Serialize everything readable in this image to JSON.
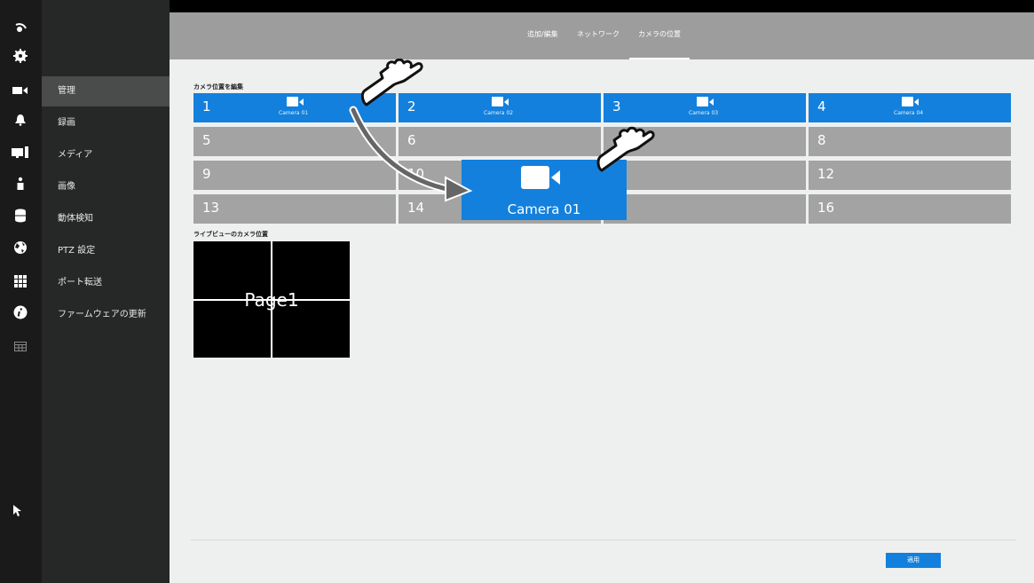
{
  "tabs": [
    {
      "label": "追加/編集"
    },
    {
      "label": "ネットワーク"
    },
    {
      "label": "カメラの位置"
    }
  ],
  "sidebar": {
    "items": [
      {
        "label": "管理",
        "icon": "camera-icon"
      },
      {
        "label": "録画",
        "icon": "bell-icon"
      },
      {
        "label": "メディア",
        "icon": "monitor-icon"
      },
      {
        "label": "画像",
        "icon": "person-icon"
      },
      {
        "label": "動体検知",
        "icon": "database-icon"
      },
      {
        "label": "PTZ 設定",
        "icon": "globe-icon"
      },
      {
        "label": "ポート転送",
        "icon": "grid-icon"
      },
      {
        "label": "ファームウェアの更新",
        "icon": "info-icon"
      }
    ]
  },
  "edit_section": {
    "label": "カメラ位置を編集",
    "cells": [
      {
        "num": "1",
        "camera": "Camera 01"
      },
      {
        "num": "2",
        "camera": "Camera 02"
      },
      {
        "num": "3",
        "camera": "Camera 03"
      },
      {
        "num": "4",
        "camera": "Camera 04"
      },
      {
        "num": "5",
        "camera": ""
      },
      {
        "num": "6",
        "camera": ""
      },
      {
        "num": "",
        "camera": ""
      },
      {
        "num": "8",
        "camera": ""
      },
      {
        "num": "9",
        "camera": ""
      },
      {
        "num": "10",
        "camera": ""
      },
      {
        "num": "",
        "camera": ""
      },
      {
        "num": "12",
        "camera": ""
      },
      {
        "num": "13",
        "camera": ""
      },
      {
        "num": "14",
        "camera": ""
      },
      {
        "num": "",
        "camera": ""
      },
      {
        "num": "16",
        "camera": ""
      }
    ]
  },
  "dragging": {
    "camera": "Camera 01"
  },
  "liveview_section": {
    "label": "ライブビューのカメラ位置",
    "page_label": "Page1"
  },
  "apply_label": "適用",
  "colors": {
    "accent": "#1380dd",
    "empty_cell": "#a2a3a2"
  }
}
